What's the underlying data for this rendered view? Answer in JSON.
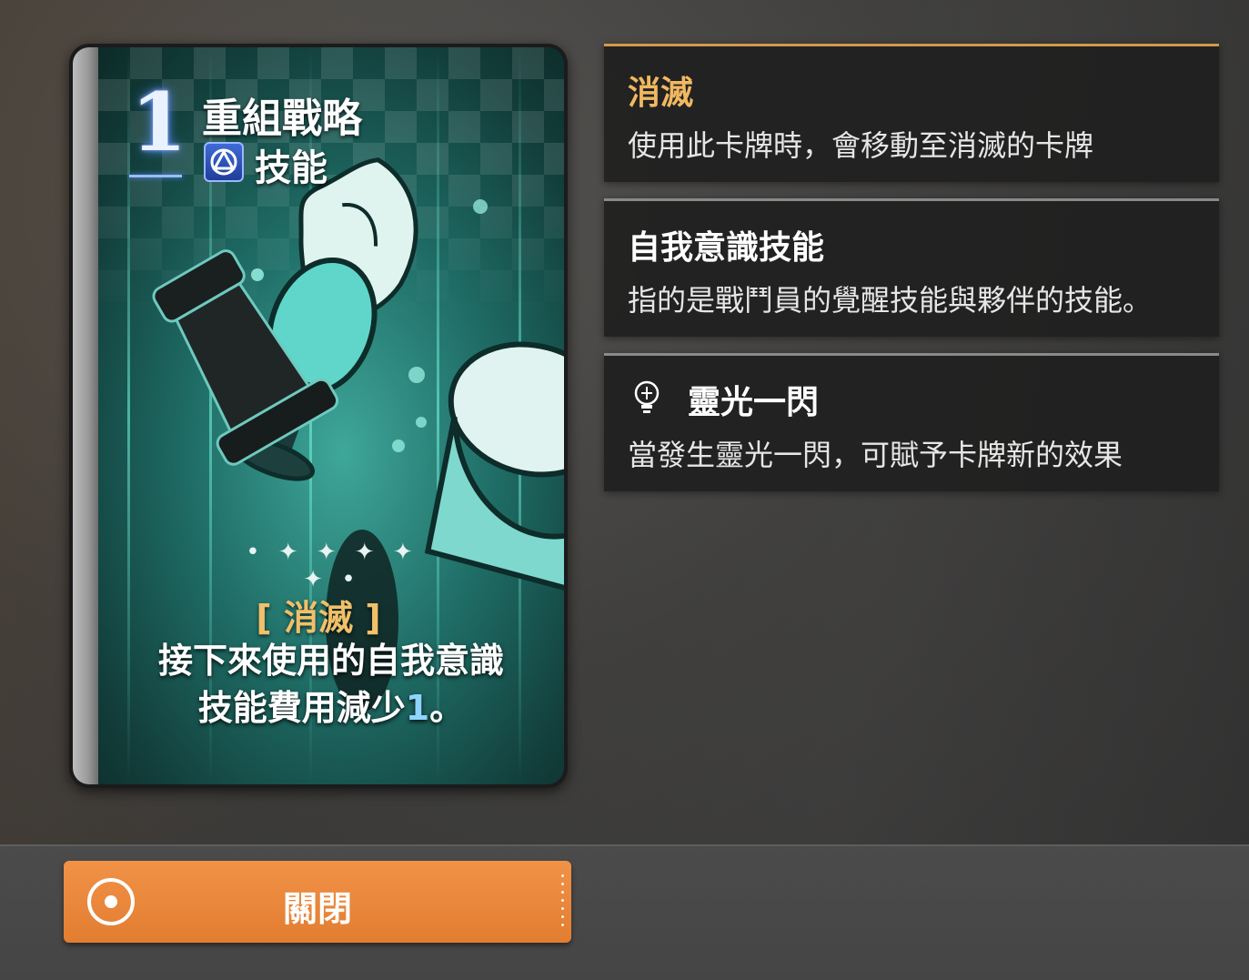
{
  "card": {
    "cost": "1",
    "title": "重組戰略",
    "type_icon": "skill-type-icon",
    "type": "技能",
    "effect_tag": "[ 消滅 ]",
    "description_line1": "接下來使用的自我意識",
    "description_line2_prefix": "技能費用減少",
    "description_number": "1",
    "description_line2_suffix": "。",
    "sparkles": "• ✦ ✦ ✦ ✦ ✦ •"
  },
  "keywords": [
    {
      "title": "消滅",
      "text": "使用此卡牌時，會移動至消滅的卡牌",
      "accent": "#f0b860"
    },
    {
      "title": "自我意識技能",
      "text": "指的是戰鬥員的覺醒技能與夥伴的技能。"
    },
    {
      "title": "靈光一閃",
      "text": "當發生靈光一閃，可賦予卡牌新的效果",
      "icon": "lightbulb-icon"
    }
  ],
  "footer": {
    "close_label": "關閉",
    "close_icon": "circle-dot-icon"
  },
  "colors": {
    "button": "#e8843a",
    "gold": "#f0b860",
    "cost_glow": "#5a8cff"
  }
}
